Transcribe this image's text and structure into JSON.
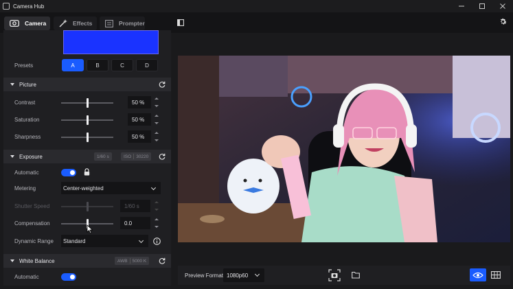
{
  "window": {
    "title": "Camera Hub"
  },
  "tabs": [
    {
      "label": "Camera",
      "icon": "camera-icon",
      "active": true
    },
    {
      "label": "Effects",
      "icon": "magic-wand-icon",
      "active": false
    },
    {
      "label": "Prompter",
      "icon": "teleprompter-icon",
      "active": false
    }
  ],
  "presets": {
    "label": "Presets",
    "options": [
      "A",
      "B",
      "C",
      "D"
    ],
    "selected": "A"
  },
  "picture": {
    "title": "Picture",
    "contrast": {
      "label": "Contrast",
      "value": "50 %",
      "level": 0.5
    },
    "saturation": {
      "label": "Saturation",
      "value": "50 %",
      "level": 0.5
    },
    "sharpness": {
      "label": "Sharpness",
      "value": "50 %",
      "level": 0.5
    }
  },
  "exposure": {
    "title": "Exposure",
    "shutter_badge": "1/60 s",
    "iso_label": "ISO",
    "iso_value": "30220",
    "automatic_label": "Automatic",
    "automatic_on": true,
    "metering": {
      "label": "Metering",
      "value": "Center-weighted"
    },
    "shutter_speed": {
      "label": "Shutter Speed",
      "value": "1/60 s",
      "level": 0.5
    },
    "compensation": {
      "label": "Compensation",
      "value": "0.0",
      "level": 0.5
    },
    "dynamic_range": {
      "label": "Dynamic Range",
      "value": "Standard"
    }
  },
  "white_balance": {
    "title": "White Balance",
    "awb_label": "AWB",
    "awb_value": "5000 K",
    "automatic_label": "Automatic",
    "automatic_on": true
  },
  "bottom_bar": {
    "preview_format_label": "Preview Format",
    "preview_format_value": "1080p60"
  },
  "colors": {
    "accent": "#1a5cff",
    "swatch": "#1a33ff",
    "panel_bg": "#1f1f22",
    "header_bg": "#2a2a2e"
  }
}
